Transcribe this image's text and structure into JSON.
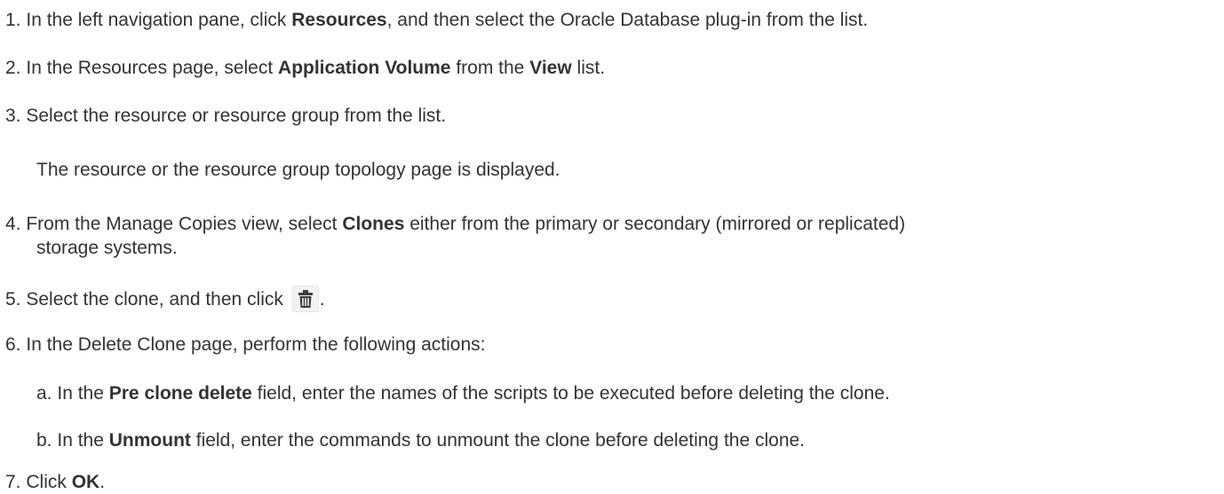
{
  "steps": [
    {
      "num": "1.",
      "t1": "In the left navigation pane, click ",
      "b1": "Resources",
      "t2": ", and then select the Oracle Database plug-in from the list."
    },
    {
      "num": "2.",
      "t1": "In the Resources page, select ",
      "b1": "Application Volume",
      "t2": " from the ",
      "b2": "View",
      "t3": " list."
    },
    {
      "num": "3.",
      "t1": "Select the resource or resource group from the list.",
      "note": "The resource or the resource group topology page is displayed."
    },
    {
      "num": "4.",
      "t1": "From the Manage Copies view, select ",
      "b1": "Clones",
      "t2": " either from the primary or secondary (mirrored or replicated)",
      "t3": "storage systems."
    },
    {
      "num": "5.",
      "t1": "Select the clone, and then click ",
      "icon": "trash-icon",
      "t2": "."
    },
    {
      "num": "6.",
      "t1": "In the Delete Clone page, perform the following actions:",
      "substeps": [
        {
          "letter": "a.",
          "t1": "In the ",
          "b1": "Pre clone delete",
          "t2": " field, enter the names of the scripts to be executed before deleting the clone."
        },
        {
          "letter": "b.",
          "t1": "In the ",
          "b1": "Unmount",
          "t2": " field, enter the commands to unmount the clone before deleting the clone."
        }
      ]
    },
    {
      "num": "7.",
      "t1": "Click ",
      "b1": "OK",
      "t2": "."
    }
  ]
}
